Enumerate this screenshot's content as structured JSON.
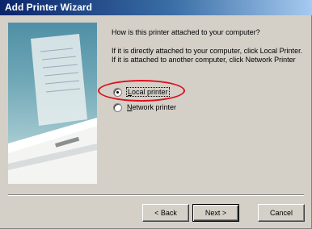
{
  "window": {
    "title": "Add Printer Wizard"
  },
  "main": {
    "question": "How is this printer attached to your computer?",
    "instructions": "If it is directly attached to your computer, click Local Printer. If it is attached to another computer, click Network Printer"
  },
  "options": {
    "local": {
      "label": "Local printer",
      "checked": true
    },
    "network": {
      "label": "Network printer",
      "checked": false
    }
  },
  "buttons": {
    "back": "< Back",
    "next": "Next >",
    "cancel": "Cancel"
  },
  "colors": {
    "titlebar_start": "#0a246a",
    "titlebar_end": "#a6caf0",
    "dialog_bg": "#d4d0c8",
    "highlight_oval": "#e0101e"
  },
  "icons": {
    "side_image": "printer-illustration-icon"
  }
}
